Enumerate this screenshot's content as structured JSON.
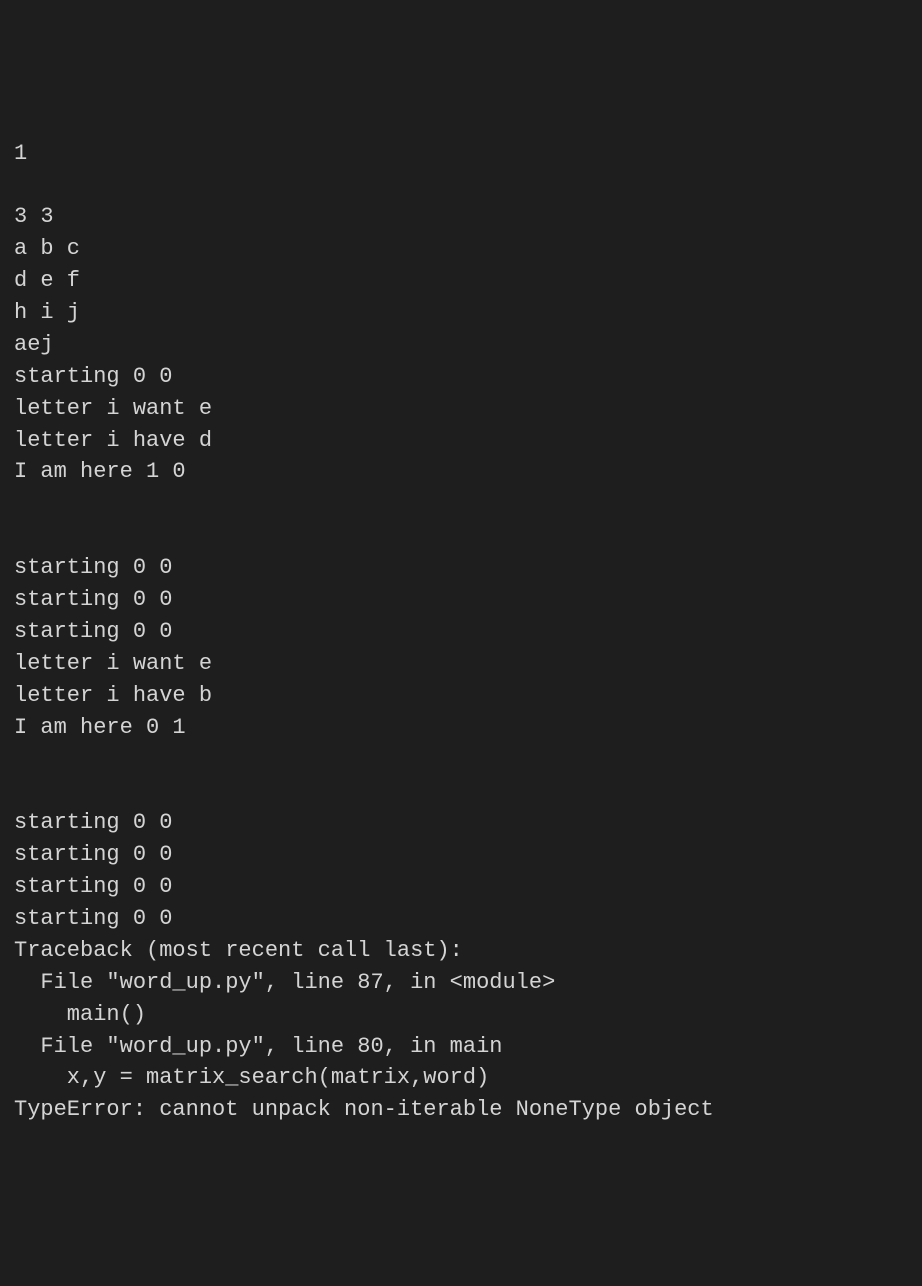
{
  "terminal": {
    "lines": [
      "1",
      "",
      "3 3",
      "a b c",
      "d e f",
      "h i j",
      "aej",
      "starting 0 0",
      "letter i want e",
      "letter i have d",
      "I am here 1 0",
      "",
      "",
      "starting 0 0",
      "starting 0 0",
      "starting 0 0",
      "letter i want e",
      "letter i have b",
      "I am here 0 1",
      "",
      "",
      "starting 0 0",
      "starting 0 0",
      "starting 0 0",
      "starting 0 0",
      "Traceback (most recent call last):",
      "  File \"word_up.py\", line 87, in <module>",
      "    main()",
      "  File \"word_up.py\", line 80, in main",
      "    x,y = matrix_search(matrix,word)",
      "TypeError: cannot unpack non-iterable NoneType object"
    ]
  }
}
